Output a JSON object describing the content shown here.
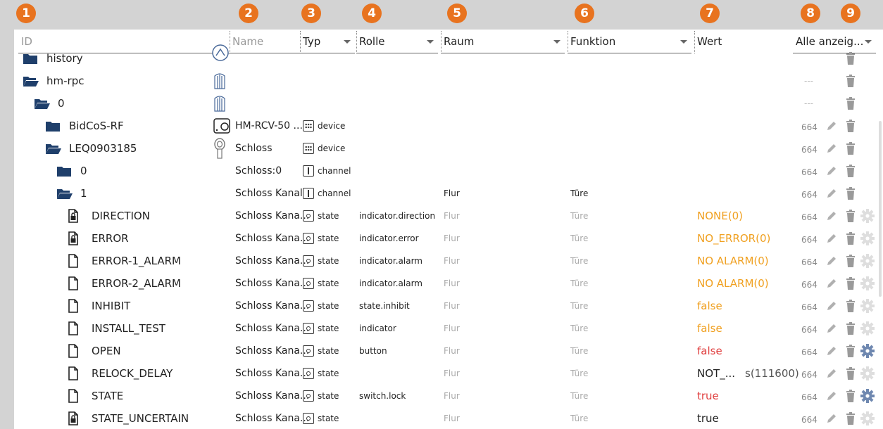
{
  "badges": [
    "1",
    "2",
    "3",
    "4",
    "5",
    "6",
    "7",
    "8",
    "9"
  ],
  "header": {
    "id_placeholder": "ID",
    "name_placeholder": "Name",
    "typ": "Typ",
    "rolle": "Rolle",
    "raum": "Raum",
    "funktion": "Funktion",
    "wert": "Wert",
    "show_all": "Alle anzeig..."
  },
  "rows": [
    {
      "id": "history",
      "indent": 0,
      "icon": "folder",
      "name": "",
      "type": "",
      "type_label": "",
      "role": "",
      "room": "",
      "func": "",
      "value": "",
      "value_extra": "",
      "value_color": "",
      "acl": "",
      "gear": false
    },
    {
      "id": "hm-rpc",
      "indent": 0,
      "icon": "folder-open",
      "name": "",
      "type": "",
      "type_label": "",
      "role": "",
      "room": "",
      "func": "",
      "value": "",
      "value_extra": "",
      "value_color": "",
      "acl": "---",
      "gear": false
    },
    {
      "id": "0",
      "indent": 1,
      "icon": "folder-open",
      "name": "",
      "type": "",
      "type_label": "",
      "role": "",
      "room": "",
      "func": "",
      "value": "",
      "value_extra": "",
      "value_color": "",
      "acl": "---",
      "gear": false
    },
    {
      "id": "BidCoS-RF",
      "indent": 2,
      "icon": "folder",
      "name": "HM-RCV-50 ...",
      "type": "device",
      "type_label": "device",
      "role": "",
      "room": "",
      "func": "",
      "value": "",
      "value_extra": "",
      "value_color": "",
      "acl": "664",
      "gear": false
    },
    {
      "id": "LEQ0903185",
      "indent": 2,
      "icon": "folder-open",
      "name": "Schloss",
      "type": "device",
      "type_label": "device",
      "role": "",
      "room": "",
      "func": "",
      "value": "",
      "value_extra": "",
      "value_color": "",
      "acl": "664",
      "gear": false
    },
    {
      "id": "0",
      "indent": 3,
      "icon": "folder",
      "name": "Schloss:0",
      "type": "channel",
      "type_label": "channel",
      "role": "",
      "room": "",
      "func": "",
      "value": "",
      "value_extra": "",
      "value_color": "",
      "acl": "664",
      "gear": false
    },
    {
      "id": "1",
      "indent": 3,
      "icon": "folder-open",
      "name": "Schloss Kanal",
      "type": "channel",
      "type_label": "channel",
      "role": "",
      "room": "Flur",
      "func": "Türe",
      "value": "",
      "value_extra": "",
      "value_color": "",
      "acl": "664",
      "gear": false,
      "strong_room": true
    },
    {
      "id": "DIRECTION",
      "indent": 4,
      "icon": "file-lock",
      "name": "Schloss Kana...",
      "type": "state",
      "type_label": "state",
      "role": "indicator.direction",
      "room": "Flur",
      "func": "Türe",
      "value": "NONE",
      "value_extra": "(0)",
      "value_color": "orange",
      "acl": "664",
      "gear": true
    },
    {
      "id": "ERROR",
      "indent": 4,
      "icon": "file-lock",
      "name": "Schloss Kana...",
      "type": "state",
      "type_label": "state",
      "role": "indicator.error",
      "room": "Flur",
      "func": "Türe",
      "value": "NO_ERROR",
      "value_extra": "(0)",
      "value_color": "orange",
      "acl": "664",
      "gear": true
    },
    {
      "id": "ERROR-1_ALARM",
      "indent": 4,
      "icon": "file",
      "name": "Schloss Kana...",
      "type": "state",
      "type_label": "state",
      "role": "indicator.alarm",
      "room": "Flur",
      "func": "Türe",
      "value": "NO ALARM",
      "value_extra": "(0)",
      "value_color": "orange",
      "acl": "664",
      "gear": true
    },
    {
      "id": "ERROR-2_ALARM",
      "indent": 4,
      "icon": "file",
      "name": "Schloss Kana...",
      "type": "state",
      "type_label": "state",
      "role": "indicator.alarm",
      "room": "Flur",
      "func": "Türe",
      "value": "NO ALARM",
      "value_extra": "(0)",
      "value_color": "orange",
      "acl": "664",
      "gear": true
    },
    {
      "id": "INHIBIT",
      "indent": 4,
      "icon": "file",
      "name": "Schloss Kana...",
      "type": "state",
      "type_label": "state",
      "role": "state.inhibit",
      "room": "Flur",
      "func": "Türe",
      "value": "false",
      "value_extra": "",
      "value_color": "orange",
      "acl": "664",
      "gear": true
    },
    {
      "id": "INSTALL_TEST",
      "indent": 4,
      "icon": "file",
      "name": "Schloss Kana...",
      "type": "state",
      "type_label": "state",
      "role": "indicator",
      "room": "Flur",
      "func": "Türe",
      "value": "false",
      "value_extra": "",
      "value_color": "orange",
      "acl": "664",
      "gear": true
    },
    {
      "id": "OPEN",
      "indent": 4,
      "icon": "file",
      "name": "Schloss Kana...",
      "type": "state",
      "type_label": "state",
      "role": "button",
      "room": "Flur",
      "func": "Türe",
      "value": "false",
      "value_extra": "",
      "value_color": "red",
      "acl": "664",
      "gear": true,
      "gear_active": true
    },
    {
      "id": "RELOCK_DELAY",
      "indent": 4,
      "icon": "file",
      "name": "Schloss Kana...",
      "type": "state",
      "type_label": "state",
      "role": "",
      "room": "Flur",
      "func": "Türe",
      "value": "NOT_...",
      "value_extra": "s(111600)",
      "value_color": "black",
      "acl": "664",
      "gear": true
    },
    {
      "id": "STATE",
      "indent": 4,
      "icon": "file",
      "name": "Schloss Kana...",
      "type": "state",
      "type_label": "state",
      "role": "switch.lock",
      "room": "Flur",
      "func": "Türe",
      "value": "true",
      "value_extra": "",
      "value_color": "red",
      "acl": "664",
      "gear": true,
      "gear_active": true
    },
    {
      "id": "STATE_UNCERTAIN",
      "indent": 4,
      "icon": "file-lock",
      "name": "Schloss Kana...",
      "type": "state",
      "type_label": "state",
      "role": "",
      "room": "Flur",
      "func": "Türe",
      "value": "true",
      "value_extra": "",
      "value_color": "black",
      "acl": "664",
      "gear": true
    }
  ]
}
